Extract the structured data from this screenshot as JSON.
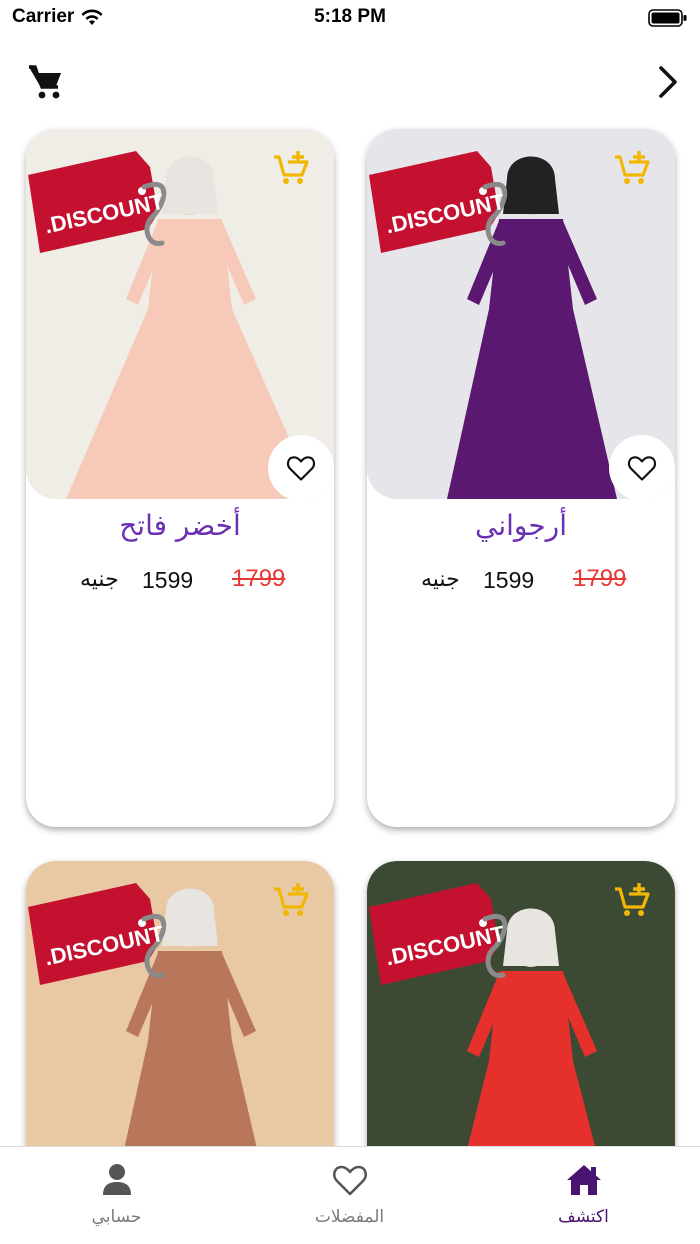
{
  "status_bar": {
    "carrier": "Carrier",
    "time": "5:18 PM"
  },
  "top_bar": {
    "cart_icon": "cart-icon",
    "back_icon": "chevron-right-icon"
  },
  "products": [
    {
      "name": "أخضر فاتح",
      "old_price": "1799",
      "new_price": "1599",
      "currency": "جنيه",
      "badge": ".DISCOUNT",
      "dress_color": "#f7c9b8",
      "bg_color": "#efede6"
    },
    {
      "name": "أرجواني",
      "old_price": "1799",
      "new_price": "1599",
      "currency": "جنيه",
      "badge": ".DISCOUNT",
      "dress_color": "#5a1870",
      "bg_color": "#e6e6ea"
    },
    {
      "name": "",
      "badge": ".DISCOUNT",
      "dress_color": "#b8765a",
      "bg_color": "#e9c9a4"
    },
    {
      "name": "",
      "badge": ".DISCOUNT",
      "dress_color": "#e5302c",
      "bg_color": "#3d4a33"
    }
  ],
  "tab_bar": {
    "tabs": [
      {
        "label": "حسابي",
        "icon": "person-icon"
      },
      {
        "label": "المفضلات",
        "icon": "heart-icon"
      },
      {
        "label": "اكتشف",
        "icon": "home-icon"
      }
    ]
  },
  "colors": {
    "accent": "#4a1570",
    "name_purple": "#6b2fb2",
    "discount_red": "#c4112f",
    "cart_yellow": "#f2b705",
    "old_price_red": "#e53935"
  }
}
